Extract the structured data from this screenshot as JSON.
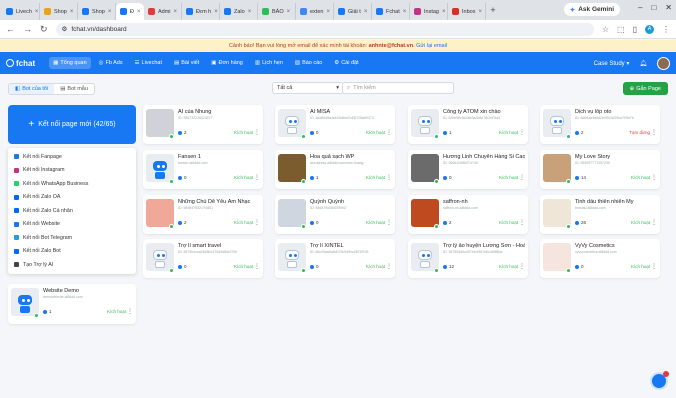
{
  "tabs": [
    {
      "label": "Livech",
      "color": "#1877f2"
    },
    {
      "label": "Shop",
      "color": "#e8a317"
    },
    {
      "label": "Shop",
      "color": "#1877f2"
    },
    {
      "label": "Đ",
      "color": "#1877f2",
      "active": true
    },
    {
      "label": "Admi",
      "color": "#e03b3b"
    },
    {
      "label": "Đơn h",
      "color": "#1877f2"
    },
    {
      "label": "Zalo",
      "color": "#1877f2"
    },
    {
      "label": "BÁO",
      "color": "#2ebd59"
    },
    {
      "label": "exten",
      "color": "#4285f4"
    },
    {
      "label": "Giải t",
      "color": "#1877f2"
    },
    {
      "label": "Fchat",
      "color": "#1877f2"
    },
    {
      "label": "Instag",
      "color": "#c13584"
    },
    {
      "label": "Inbox",
      "color": "#d93025"
    }
  ],
  "browser": {
    "url": "fchat.vn/dashboard",
    "gemini": "Ask Gemini",
    "profile": "A"
  },
  "warning": {
    "pre": "Cảnh báo! Bạn vui lòng mở email để xác minh tài khoản:",
    "email": "anhnte@fchat.vn",
    "link": "Gửi lại email"
  },
  "nav": {
    "brand": "fchat",
    "items": [
      "Tổng quan",
      "Fb Ads",
      "Livechat",
      "Bài viết",
      "Đơn hàng",
      "Lịch hẹn",
      "Báo cáo",
      "Cài đặt"
    ],
    "account": "Case Study"
  },
  "toolbar": {
    "seg1": "Bot của tôi",
    "seg2": "Bot mẫu",
    "filter": "Tất cả",
    "search_placeholder": "Tìm kiếm",
    "add": "Gắn Page"
  },
  "connect": {
    "label": "Kết nối page mới (42/65)"
  },
  "dropdown": [
    {
      "label": "Kết nối Fanpage",
      "color": "#1877f2"
    },
    {
      "label": "Kết nối Instagram",
      "color": "#c13584"
    },
    {
      "label": "Kết nối WhatsApp Business",
      "color": "#25d366"
    },
    {
      "label": "Kết nối Zalo OA",
      "color": "#0068ff"
    },
    {
      "label": "Kết nối Zalo Cá nhân",
      "color": "#0068ff"
    },
    {
      "label": "Kết nối Website",
      "color": "#1877f2"
    },
    {
      "label": "Kết nối Bot Telegram",
      "color": "#229ed9"
    },
    {
      "label": "Kết nối Zalo Bot",
      "color": "#0068ff"
    },
    {
      "label": "Tạo Trợ lý AI",
      "color": "#444"
    }
  ],
  "cards": [
    {
      "name": "AI của Nhung",
      "sub": "ID: 958732226024077",
      "count": "2",
      "status": "Kích hoạt",
      "img": "#cfd3d8"
    },
    {
      "name": "AI MISA",
      "sub": "ID: a5d86d5a4bb2fa6ba7b49f728a69374",
      "count": "0",
      "status": "Kích hoạt",
      "img": "bot"
    },
    {
      "name": "Công ty ATOM xin chào",
      "sub": "ID: 62fef58c8d4bb3a2b8e7fb2eF5a4",
      "count": "1",
      "status": "Kích hoạt",
      "img": "bot"
    },
    {
      "name": "Dịch vụ lốp oto",
      "sub": "ID: 6d69aa4a6d2b9f923c09bd7f3fd7b",
      "count": "2",
      "status": "Tạm dừng",
      "img": "bot"
    },
    {
      "name": "Fansen 1",
      "sub": "fansen.ai8ddd.com",
      "count": "0",
      "status": "Kích hoạt",
      "img": "bluebot"
    },
    {
      "name": "Hoa quả sạch WP",
      "sub": "wordpress.ai8ddd.com/new-hoang",
      "count": "1",
      "status": "Kích hoạt",
      "img": "#7a5c2e"
    },
    {
      "name": "Hương Linh Chuyên Hàng Si Cao cấp",
      "sub": "ID: 9066420860T4745",
      "count": "0",
      "status": "Kích hoạt",
      "img": "#6b6b6b"
    },
    {
      "name": "My Love Story",
      "sub": "ID: 9930577T7057290",
      "count": "14",
      "status": "Kích hoạt",
      "img": "#c8a07a"
    },
    {
      "name": "Những Chú Dê Yêu Âm Nhạc",
      "sub": "ID: 5596975521Y0801",
      "count": "2",
      "status": "Kích hoạt",
      "img": "#f0a898"
    },
    {
      "name": "Quỳnh Quỳnh",
      "sub": "ID: 5465790089059947",
      "count": "0",
      "status": "Kích hoạt",
      "img": "#cfd6e0"
    },
    {
      "name": "saffron-nh",
      "sub": "saffron-nh.ai8ddd.com",
      "count": "2",
      "status": "Kích hoạt",
      "img": "#c04a1f"
    },
    {
      "name": "Tinh dầu thiên nhiên My",
      "sub": "tinhdau.ai8ddd.com",
      "count": "26",
      "status": "Kích hoạt",
      "img": "#efe6d8"
    },
    {
      "name": "Trợ lí smart travel",
      "sub": "ID: 5679b4caa2848b2476d9d8fd4T09",
      "count": "0",
      "status": "Kích hoạt",
      "img": "bot"
    },
    {
      "name": "Trợ lí XINTEL",
      "sub": "ID: 8dc09aa6a8d079c5d5ec0875f7d5",
      "count": "0",
      "status": "Kích hoạt",
      "img": "bot"
    },
    {
      "name": "Trợ lý ảo huyện Lương Sơn - Hoà Bình",
      "sub": "ID: 397593d0c457e4cf967e6c469f8ba",
      "count": "12",
      "status": "Kích hoạt",
      "img": "bot"
    },
    {
      "name": "VyVy Cosmetics",
      "sub": "vyvycosmetics.ai8ddd.com",
      "count": "0",
      "status": "Kích hoạt",
      "img": "#f5e5de"
    },
    {
      "name": "Website Demo",
      "sub": "demowebsite.ai8ddd.com",
      "count": "1",
      "status": "Kích hoạt",
      "img": "bluebot"
    }
  ]
}
